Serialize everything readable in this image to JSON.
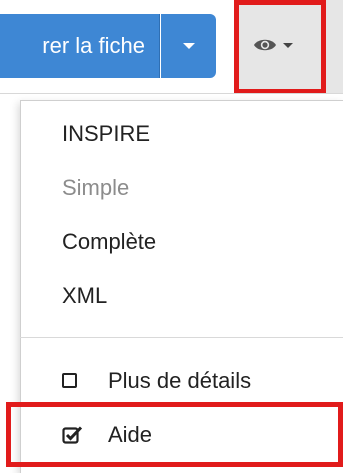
{
  "toolbar": {
    "save_button_label": "rer la fiche",
    "primary_color": "#3e87d4",
    "view_button": {
      "icon": "eye-icon",
      "background": "#e6e6e6"
    }
  },
  "view_menu": {
    "formats": [
      {
        "label": "INSPIRE",
        "disabled": false
      },
      {
        "label": "Simple",
        "disabled": true
      },
      {
        "label": "Complète",
        "disabled": false
      },
      {
        "label": "XML",
        "disabled": false
      }
    ],
    "options": [
      {
        "label": "Plus de détails",
        "checked": false
      },
      {
        "label": "Aide",
        "checked": true
      }
    ]
  },
  "annotations": {
    "highlight_color": "#e11b1b"
  }
}
